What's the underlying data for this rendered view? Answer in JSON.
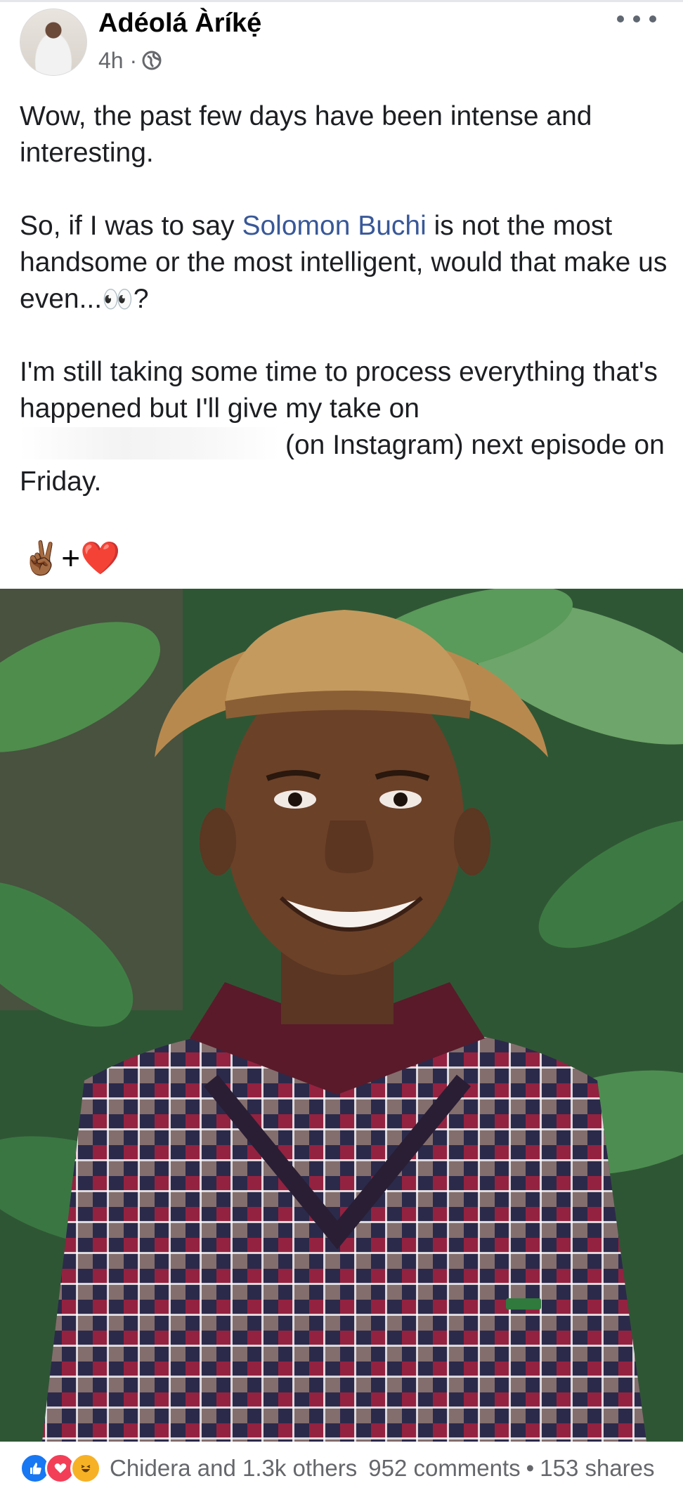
{
  "post": {
    "author": "Adéolá Àríkẹ́",
    "time": "4h ·",
    "paragraphs": {
      "p1": "Wow, the past few days have been intense and interesting.",
      "p2_before": "So, if I was to say ",
      "p2_link": "Solomon Buchi",
      "p2_after": " is not the most handsome or the most intelligent, would that make us even...",
      "p2_emoji": "👀",
      "p2_end": "?",
      "p3_before": "I'm still taking some time to process everything that's happened but I'll give my take on ",
      "p3_after": "(on Instagram) next episode on Friday."
    },
    "emoji_line": "✌🏾+❤️"
  },
  "footer": {
    "reactions_text": "Chidera and 1.3k others",
    "comments": "952 comments",
    "separator": "•",
    "shares": "153 shares"
  },
  "colors": {
    "link": "#385898",
    "like": "#1877f2",
    "love": "#f33e58",
    "haha": "#f7b125"
  },
  "icons": {
    "more": "more-horizontal-icon",
    "privacy": "globe-icon",
    "reactions": [
      "like-icon",
      "love-icon",
      "haha-icon"
    ]
  }
}
